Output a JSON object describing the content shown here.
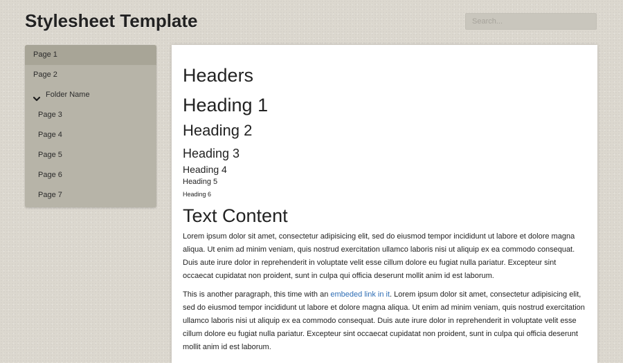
{
  "header": {
    "title": "Stylesheet Template",
    "search_placeholder": "Search..."
  },
  "sidebar": {
    "items": [
      {
        "label": "Page 1"
      },
      {
        "label": "Page 2"
      },
      {
        "label": "Folder Name",
        "icon": "chevron-down-icon"
      },
      {
        "label": "Page 3"
      },
      {
        "label": "Page 4"
      },
      {
        "label": "Page 5"
      },
      {
        "label": "Page 6"
      },
      {
        "label": "Page 7"
      }
    ]
  },
  "content": {
    "section1_title": "Headers",
    "h1": "Heading 1",
    "h2": "Heading 2",
    "h3": "Heading 3",
    "h4": "Heading 4",
    "h5": "Heading 5",
    "h6": "Heading 6",
    "section2_title": "Text Content",
    "paragraph1": "Lorem ipsum dolor sit amet, consectetur adipisicing elit, sed do eiusmod tempor incididunt ut labore et dolore magna aliqua. Ut enim ad minim veniam, quis nostrud exercitation ullamco laboris nisi ut aliquip ex ea commodo consequat. Duis aute irure dolor in reprehenderit in voluptate velit esse cillum dolore eu fugiat nulla pariatur. Excepteur sint occaecat cupidatat non proident, sunt in culpa qui officia deserunt mollit anim id est laborum.",
    "paragraph2_before": "This is another paragraph, this time with an ",
    "paragraph2_link": "embeded link in it",
    "paragraph2_after": ". Lorem ipsum dolor sit amet, consectetur adipisicing elit, sed do eiusmod tempor incididunt ut labore et dolore magna aliqua. Ut enim ad minim veniam, quis nostrud exercitation ullamco laboris nisi ut aliquip ex ea commodo consequat. Duis aute irure dolor in reprehenderit in voluptate velit esse cillum dolore eu fugiat nulla pariatur. Excepteur sint occaecat cupidatat non proident, sunt in culpa qui officia deserunt mollit anim id est laborum."
  },
  "colors": {
    "background": "#dcd8cf",
    "sidebar": "#b7b4a8",
    "sidebar_active": "#a8a597",
    "link": "#2e6db4"
  }
}
